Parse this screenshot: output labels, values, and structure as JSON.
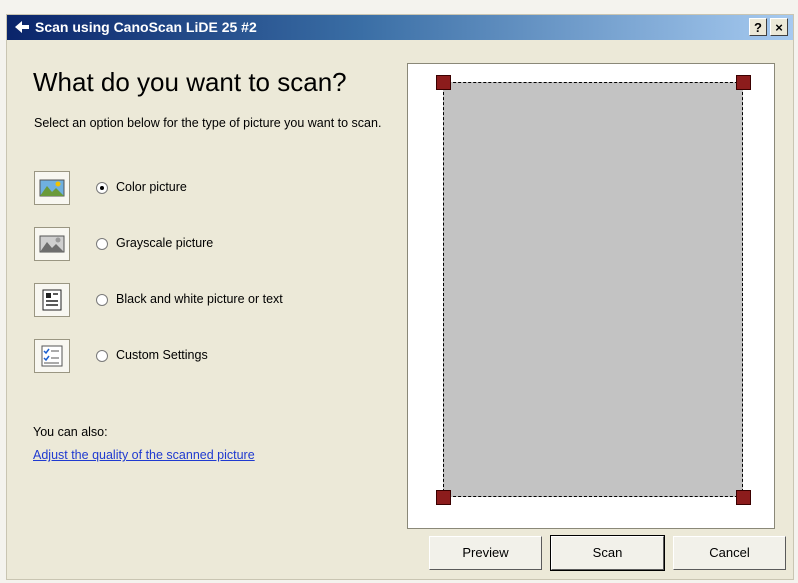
{
  "window": {
    "title": "Scan using CanoScan LiDE 25 #2",
    "help_label": "?",
    "close_label": "×"
  },
  "main": {
    "heading": "What do you want to scan?",
    "instructions": "Select an option below for the type of picture you want to scan.",
    "options": [
      {
        "label": "Color picture",
        "icon": "color-picture-icon",
        "checked": true
      },
      {
        "label": "Grayscale picture",
        "icon": "grayscale-picture-icon",
        "checked": false
      },
      {
        "label": "Black and white picture or text",
        "icon": "bw-picture-icon",
        "checked": false
      },
      {
        "label": "Custom Settings",
        "icon": "custom-settings-icon",
        "checked": false
      }
    ],
    "also_label": "You can also:",
    "adjust_link": "Adjust the quality of the scanned picture"
  },
  "buttons": {
    "preview": "Preview",
    "scan": "Scan",
    "cancel": "Cancel"
  },
  "colors": {
    "title_bar": "#0a246a",
    "scan_area": "#c3c3c3",
    "crop_handle": "#8c1c1c",
    "link": "#1f3ad0"
  }
}
